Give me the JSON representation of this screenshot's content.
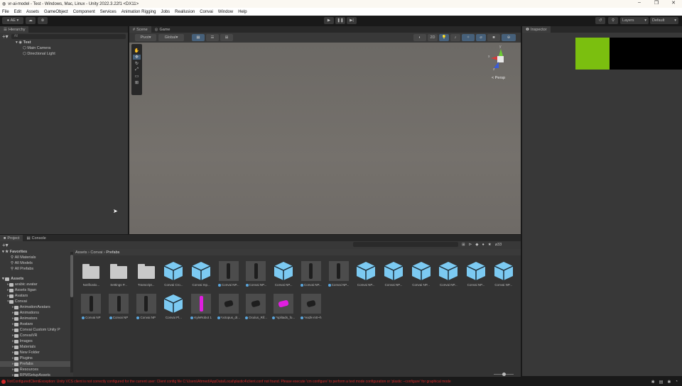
{
  "window": {
    "title": "vr-ai-model - Test - Windows, Mac, Linux - Unity 2022.3.22f1 <DX11>",
    "minimize": "–",
    "maximize": "❐",
    "close": "✕"
  },
  "menu": [
    "File",
    "Edit",
    "Assets",
    "GameObject",
    "Component",
    "Services",
    "Animation Rigging",
    "Jobs",
    "Reallusion",
    "Convai",
    "Window",
    "Help"
  ],
  "toolbar": {
    "account": "AE ▾",
    "layers": "Layers",
    "layout": "Default"
  },
  "hierarchy": {
    "tab": "Hierarchy",
    "search_placeholder": "All",
    "scene": "Test",
    "objects": [
      "Main Camera",
      "Directional Light"
    ]
  },
  "scene": {
    "tabs": [
      "Scene",
      "Game"
    ],
    "pivot": "Pivot",
    "global": "Global",
    "mode_2d": "2D",
    "persp": "< Persp",
    "axes": {
      "x": "x",
      "y": "y",
      "z": "z"
    }
  },
  "inspector": {
    "tab": "Inspector",
    "accent": "#7bbf0f"
  },
  "project": {
    "tabs": [
      "Project",
      "Console"
    ],
    "favorites_label": "Favorites",
    "favorites": [
      "All Materials",
      "All Models",
      "All Prefabs"
    ],
    "assets_label": "Assets",
    "tree": [
      {
        "label": "arabic avatar",
        "depth": 1
      },
      {
        "label": "Assets Itgan",
        "depth": 1
      },
      {
        "label": "Avatars",
        "depth": 1
      },
      {
        "label": "Convai",
        "depth": 1
      },
      {
        "label": "AnimationAvatars",
        "depth": 2
      },
      {
        "label": "Animations",
        "depth": 2
      },
      {
        "label": "Animators",
        "depth": 2
      },
      {
        "label": "Avatars",
        "depth": 2
      },
      {
        "label": "Convai Custom Unity P",
        "depth": 2
      },
      {
        "label": "ConvaiVR",
        "depth": 2
      },
      {
        "label": "Images",
        "depth": 2
      },
      {
        "label": "Materials",
        "depth": 2
      },
      {
        "label": "New Folder",
        "depth": 2
      },
      {
        "label": "Plugins",
        "depth": 2
      },
      {
        "label": "Prefabs",
        "depth": 2,
        "selected": true
      },
      {
        "label": "Resources",
        "depth": 2
      },
      {
        "label": "RPMSetupAssets",
        "depth": 2
      }
    ],
    "breadcrumb": [
      "Assets",
      "Convai",
      "Prefabs"
    ],
    "hidden_count": "33",
    "assets": [
      {
        "name": "Notificatio...",
        "kind": "folder"
      },
      {
        "name": "Settings P...",
        "kind": "folder"
      },
      {
        "name": "Transcript...",
        "kind": "folder"
      },
      {
        "name": "Convai Cro...",
        "kind": "prefab"
      },
      {
        "name": "Convai Inp...",
        "kind": "prefab"
      },
      {
        "name": "Convai NP...",
        "kind": "model"
      },
      {
        "name": "Convai NP...",
        "kind": "model"
      },
      {
        "name": "Convai NP...",
        "kind": "prefab"
      },
      {
        "name": "Convai NP...",
        "kind": "model"
      },
      {
        "name": "Convai NP...",
        "kind": "model"
      },
      {
        "name": "Convai NP...",
        "kind": "prefab"
      },
      {
        "name": "Convai NP...",
        "kind": "prefab"
      },
      {
        "name": "Convai NP...",
        "kind": "prefab"
      },
      {
        "name": "Convai NP...",
        "kind": "prefab"
      },
      {
        "name": "Convai NP...",
        "kind": "prefab"
      },
      {
        "name": "Convai NP...",
        "kind": "prefab"
      },
      {
        "name": "Convai NP",
        "kind": "model"
      },
      {
        "name": "Convai NP",
        "kind": "model"
      },
      {
        "name": "Convai NP",
        "kind": "model"
      },
      {
        "name": "Convai Pl...",
        "kind": "prefab"
      },
      {
        "name": "KyleRobot 1",
        "kind": "magenta"
      },
      {
        "name": "*octopus_dr...",
        "kind": "object"
      },
      {
        "name": "Oculus_Rif...",
        "kind": "object"
      },
      {
        "name": "*splitads_fo...",
        "kind": "magenta2"
      },
      {
        "name": "*ea2k-m0~h",
        "kind": "object"
      }
    ]
  },
  "status": {
    "message": "NotConfiguredClientException: Unity VCS client is not correctly configured for the current user: Client config file C:\\Users\\Ahmed\\AppData\\Local\\plastic4\\client.conf not found. Please execute 'cm configure' to perform a text mode configuration or 'plastic --configure' for graphical mode",
    "color": "#d02a2a"
  }
}
